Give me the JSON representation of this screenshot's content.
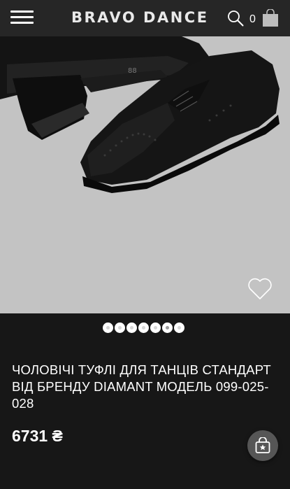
{
  "header": {
    "menu_icon": "hamburger-menu-icon",
    "logo": "BRAVO DANCE",
    "search_icon": "search-icon",
    "cart_count": "0",
    "cart_icon": "shopping-bag-icon"
  },
  "gallery": {
    "image": "black men's dance shoes",
    "wishlist_icon": "heart-icon",
    "slide_count": 7,
    "active_slide": 6
  },
  "product": {
    "title": "ЧОЛОВІЧІ ТУФЛІ ДЛЯ ТАНЦІВ СТАНДАРТ ВІД БРЕНДУ DIAMANT МОДЕЛЬ 099-025-028",
    "price": "6731 ₴"
  },
  "fab": {
    "icon": "shopping-bag-star-icon"
  },
  "colors": {
    "header_bg": "#262626",
    "page_bg": "#171717",
    "image_bg": "#c3c3c3",
    "fab_bg": "#565656"
  }
}
